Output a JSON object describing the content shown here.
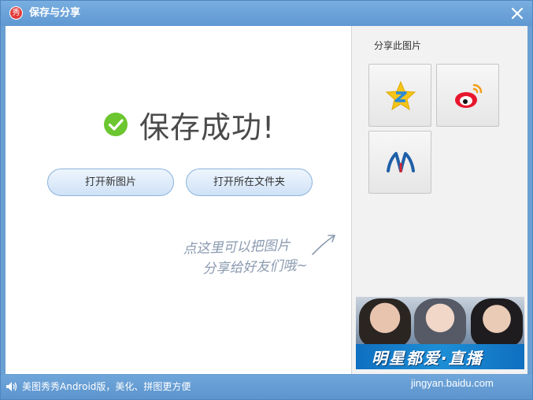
{
  "window": {
    "title": "保存与分享",
    "app_icon_glyph": "秀"
  },
  "main": {
    "success_text": "保存成功!",
    "open_new_label": "打开新图片",
    "open_folder_label": "打开所在文件夹",
    "hint_line1": "点这里可以把图片",
    "hint_line2": "分享给好友们哦~"
  },
  "share": {
    "title": "分享此图片",
    "buttons": [
      {
        "icon": "qzone-icon"
      },
      {
        "icon": "weibo-icon"
      },
      {
        "icon": "renren-icon"
      }
    ]
  },
  "ad": {
    "text": "明星都爱·直播"
  },
  "statusbar": {
    "text": "美图秀秀Android版，美化、拼图更方便",
    "watermark": "jingyan.baidu.com"
  },
  "colors": {
    "titlebar": "#5f98d1",
    "check_green": "#6cc62f",
    "button_border": "#8cb4dc"
  }
}
